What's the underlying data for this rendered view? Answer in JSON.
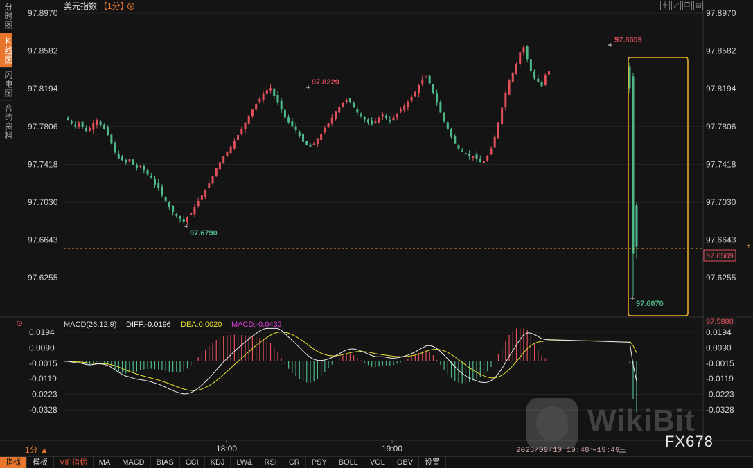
{
  "left_tabs": [
    {
      "label": "分时图",
      "active": false
    },
    {
      "label": "K线图",
      "active": true
    },
    {
      "label": "闪电图",
      "active": false
    },
    {
      "label": "合约资料",
      "active": false
    }
  ],
  "header": {
    "title": "美元指数",
    "period_tag": "【1分】",
    "add_icon": "plus-circle-icon"
  },
  "window_icons": [
    "crosshair-icon",
    "expand-icon",
    "restore-icon",
    "layout-icon"
  ],
  "price_axis": {
    "ticks": [
      "97.8970",
      "97.8582",
      "97.8194",
      "97.7806",
      "97.7418",
      "97.7030",
      "97.6643",
      "97.6255"
    ],
    "current_price": "97.6569",
    "indicator_top_value": "97.5888"
  },
  "annotations": {
    "low_left": "97.6790",
    "high_mid": "97.8229",
    "high_right": "97.8659",
    "low_right": "97.6070"
  },
  "macd": {
    "title": "MACD(26,12,9)",
    "diff_label": "DIFF:-0.0196",
    "dea_label": "DEA:0.0020",
    "macd_label": "MACD:-0.0432",
    "ticks": [
      "0.0194",
      "0.0090",
      "-0.0015",
      "-0.0119",
      "-0.0223",
      "-0.0328"
    ]
  },
  "time_axis": {
    "labels": [
      "18:00",
      "19:00"
    ]
  },
  "footer": {
    "period_button": "1分 ▲",
    "time_range": "2025/09/10 19:48～19:49",
    "range_icon": "三"
  },
  "bottom_toolbar": [
    "指标",
    "模板",
    "VIP指标",
    "MA",
    "MACD",
    "BIAS",
    "CCI",
    "KDJ",
    "LW&",
    "RSI",
    "CR",
    "PSY",
    "BOLL",
    "VOL",
    "OBV",
    "设置"
  ],
  "watermark": {
    "brand": "WikiBit",
    "code": "FX678"
  },
  "colors": {
    "up": "#e0505a",
    "down": "#4fb98a",
    "accent": "#e8762c",
    "highlight_box": "#f0b429",
    "dea_line": "#e8e030",
    "diff_line": "#f0f0f0",
    "macd_label": "#e040e0"
  },
  "chart_data": {
    "type": "candlestick",
    "price_range": [
      97.6,
      97.9
    ],
    "macd_range": [
      -0.034,
      0.022
    ],
    "close_path": [
      97.789,
      97.787,
      97.784,
      97.781,
      97.785,
      97.78,
      97.776,
      97.779,
      97.784,
      97.787,
      97.782,
      97.778,
      97.772,
      97.763,
      97.754,
      97.748,
      97.746,
      97.744,
      97.747,
      97.741,
      97.738,
      97.74,
      97.736,
      97.731,
      97.728,
      97.721,
      97.718,
      97.71,
      97.704,
      97.698,
      97.693,
      97.689,
      97.686,
      97.683,
      97.688,
      97.692,
      97.698,
      97.704,
      97.71,
      97.716,
      97.722,
      97.73,
      97.738,
      97.744,
      97.75,
      97.755,
      97.76,
      97.766,
      97.772,
      97.778,
      97.785,
      97.792,
      97.798,
      97.804,
      97.809,
      97.814,
      97.818,
      97.82,
      97.812,
      97.805,
      97.798,
      97.79,
      97.785,
      97.781,
      97.777,
      97.771,
      97.765,
      97.762,
      97.76,
      97.763,
      97.768,
      97.773,
      97.779,
      97.784,
      97.79,
      97.796,
      97.801,
      97.805,
      97.808,
      97.806,
      97.8,
      97.795,
      97.791,
      97.788,
      97.785,
      97.783,
      97.786,
      97.79,
      97.793,
      97.789,
      97.786,
      97.79,
      97.794,
      97.798,
      97.802,
      97.806,
      97.811,
      97.816,
      97.823,
      97.829,
      97.831,
      97.825,
      97.815,
      97.805,
      97.795,
      97.786,
      97.778,
      97.77,
      97.763,
      97.758,
      97.755,
      97.752,
      97.75,
      97.75,
      97.747,
      97.744,
      97.745,
      97.75,
      97.758,
      97.77,
      97.785,
      97.8,
      97.815,
      97.828,
      97.836,
      97.845,
      97.857,
      97.862,
      97.85,
      97.838,
      97.83,
      97.826,
      97.822,
      97.833,
      97.838
    ],
    "crash_candles": [
      {
        "open": 97.842,
        "high": 97.846,
        "low": 97.815,
        "close": 97.82
      },
      {
        "open": 97.832,
        "high": 97.836,
        "low": 97.607,
        "close": 97.65
      },
      {
        "open": 97.7,
        "high": 97.703,
        "low": 97.645,
        "close": 97.657
      }
    ]
  }
}
